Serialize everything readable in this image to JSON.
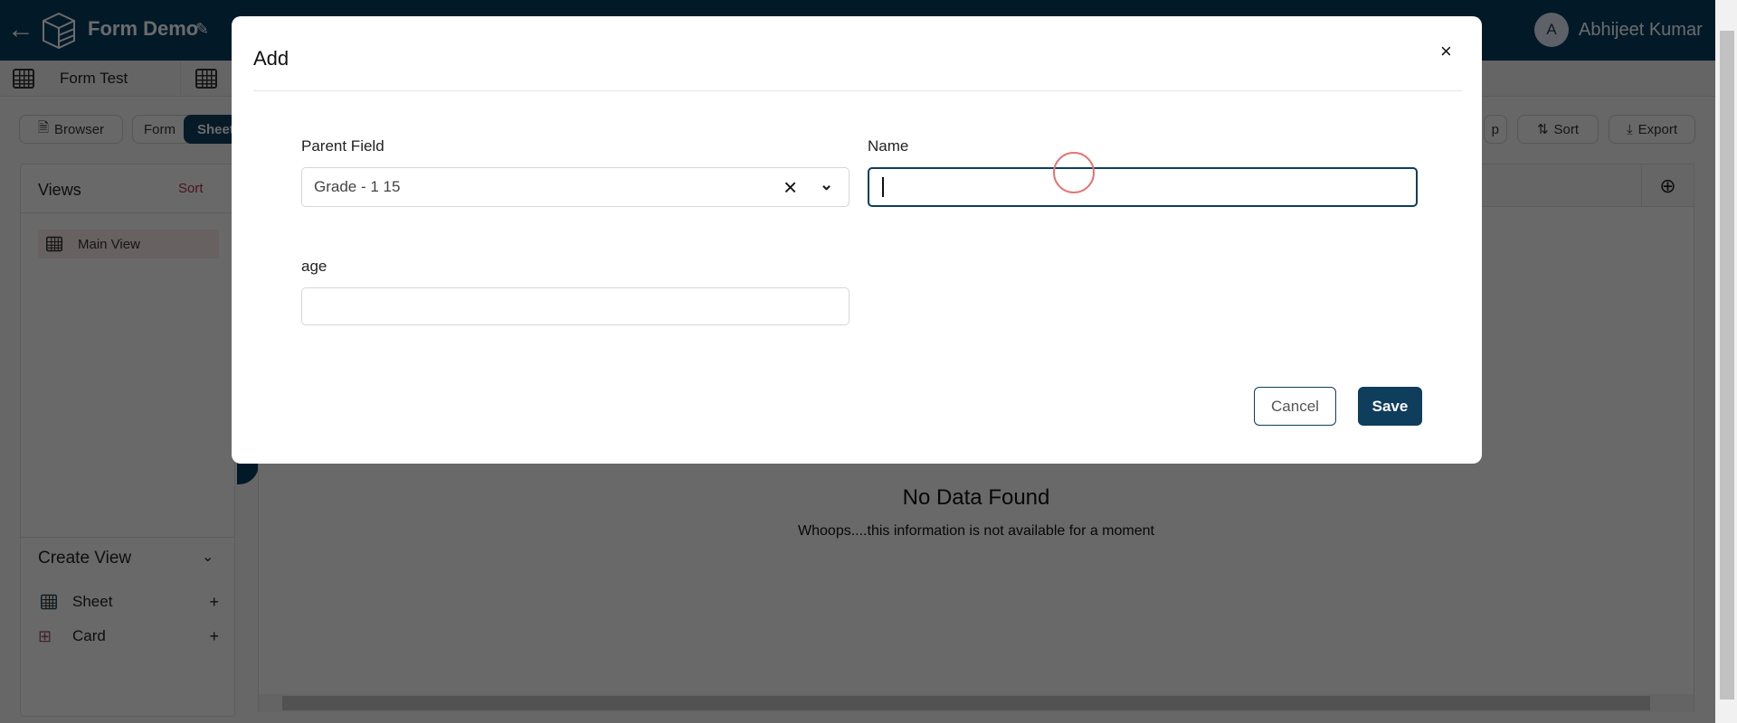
{
  "header": {
    "title": "Form Demo",
    "user_initial": "A",
    "user_name": "Abhijeet Kumar"
  },
  "tabs": [
    {
      "label": "Form Test"
    },
    {
      "label": ""
    }
  ],
  "toolbar": {
    "browser": "Browser",
    "form": "Form",
    "sheet": "Sheet",
    "group": "p",
    "sort": "Sort",
    "export": "Export"
  },
  "sidebar": {
    "views_title": "Views",
    "sort_label": "Sort",
    "views": [
      {
        "label": "Main View"
      }
    ],
    "create_view_title": "Create View",
    "create_items": [
      {
        "label": "Sheet",
        "icon": "grid-icon"
      },
      {
        "label": "Card",
        "icon": "card-icon"
      }
    ]
  },
  "main": {
    "empty_title": "No Data Found",
    "empty_subtitle": "Whoops....this information is not available for a moment"
  },
  "modal": {
    "title": "Add",
    "fields": {
      "parent_label": "Parent Field",
      "parent_value": "Grade - 1 15",
      "name_label": "Name",
      "name_value": "",
      "age_label": "age",
      "age_value": ""
    },
    "cancel": "Cancel",
    "save": "Save"
  },
  "colors": {
    "primary": "#0f3d5c",
    "header": "#043b60",
    "accent": "#b0304a"
  }
}
